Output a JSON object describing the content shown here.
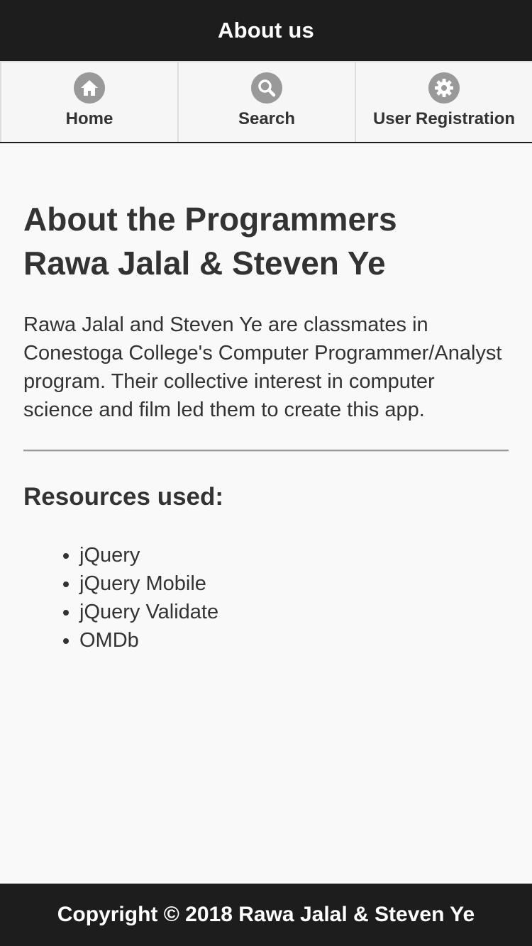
{
  "header": {
    "title": "About us"
  },
  "nav": {
    "items": [
      {
        "label": "Home",
        "icon": "home-icon"
      },
      {
        "label": "Search",
        "icon": "search-icon"
      },
      {
        "label": "User Registration",
        "icon": "gear-icon"
      }
    ]
  },
  "main": {
    "heading_line1": "About the Programmers",
    "heading_line2": "Rawa Jalal & Steven Ye",
    "paragraph": "Rawa Jalal and Steven Ye are classmates in Conestoga College's Computer Programmer/Analyst program. Their collective interest in computer science and film led them to create this app.",
    "resources_heading": "Resources used:",
    "resources": [
      "jQuery",
      "jQuery Mobile",
      "jQuery Validate",
      "OMDb"
    ]
  },
  "footer": {
    "text": "Copyright © 2018 Rawa Jalal & Steven Ye"
  },
  "colors": {
    "bar_background": "#1d1d1d",
    "page_background": "#f9f9f9",
    "icon_disc": "#999999",
    "text": "#333333"
  }
}
